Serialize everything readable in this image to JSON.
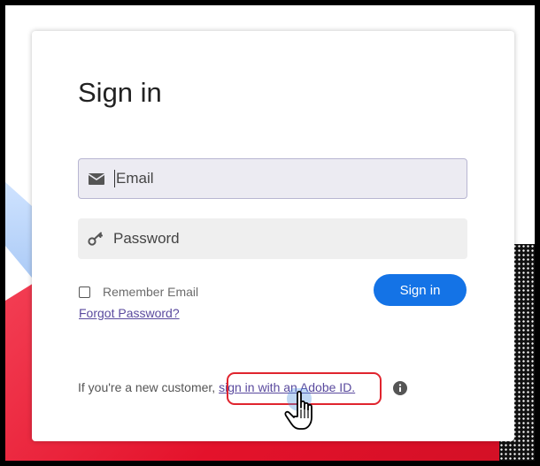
{
  "title": "Sign in",
  "email": {
    "placeholder": "Email",
    "icon": "mail-icon"
  },
  "password": {
    "placeholder": "Password",
    "icon": "key-icon"
  },
  "remember": {
    "label": "Remember Email",
    "checked": false
  },
  "forgot": {
    "label": "Forgot Password?"
  },
  "signin_button": {
    "label": "Sign in",
    "color": "#1473e6"
  },
  "footer": {
    "prefix": "If you're a new customer, ",
    "link": "sign in with an Adobe ID.",
    "info_icon": "info-icon"
  },
  "colors": {
    "accent": "#1473e6",
    "link": "#5a4a9e",
    "highlight": "#e0242e",
    "background_red": "#e4122b"
  }
}
